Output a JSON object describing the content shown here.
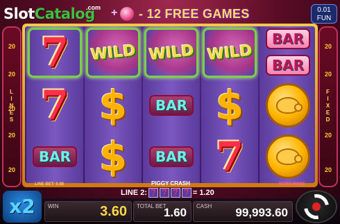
{
  "logo": {
    "part1": "Slot",
    "part2": "Catalog",
    "suffix": ".com"
  },
  "header": {
    "free_games_text": "- 12 FREE GAMES",
    "plus": "+"
  },
  "fun_box": {
    "value": "0.01",
    "label": "FUN"
  },
  "lines_panel": {
    "left_label": "LINES",
    "right_label": "FIXED",
    "numbers": [
      "20",
      "20",
      "20",
      "20",
      "20",
      "20",
      "20",
      "20",
      "20",
      "20"
    ]
  },
  "reels": [
    [
      "seven",
      "seven",
      "bar"
    ],
    [
      "wild",
      "dollar",
      "dollar"
    ],
    [
      "wild",
      "bar",
      "bar"
    ],
    [
      "wild",
      "dollar",
      "seven"
    ],
    [
      "bar-stack",
      "coin",
      "coin"
    ]
  ],
  "symbols": {
    "bar": "BAR",
    "wild": "WILD",
    "seven": "7",
    "dollar": "$"
  },
  "footer_strip": {
    "line_bet": "LINE BET: 0.08",
    "demo_mode": "DEMO MODE",
    "piggy_crash": "PIGGY CRASH"
  },
  "win_line": {
    "label": "LINE 2:",
    "result": "= 1.20",
    "mini_symbol": "7"
  },
  "multiplier": "x2",
  "panels": {
    "win": {
      "label": "WIN",
      "value": "3.60"
    },
    "total_bet": {
      "label": "TOTAL BET",
      "value": "1.60"
    },
    "cash": {
      "label": "CASH",
      "value": "99,993.60"
    }
  },
  "colors": {
    "accent_gold": "#ffd84a",
    "frame": "#f7c84a",
    "highlight_green": "#7bd04a"
  },
  "icons": {
    "spin": "autoplay-spin-icon",
    "bonus": "piggy-bonus-icon"
  }
}
